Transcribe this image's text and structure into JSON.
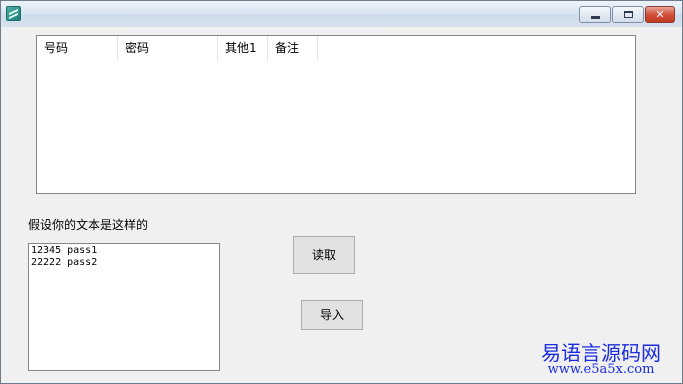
{
  "window": {
    "title": ""
  },
  "listview": {
    "columns": [
      "号码",
      "密码",
      "其他1",
      "备注"
    ]
  },
  "sample_label": "假设你的文本是这样的",
  "textbox": {
    "lines": [
      "12345 pass1",
      "22222 pass2"
    ]
  },
  "buttons": {
    "read": "读取",
    "import": "导入"
  },
  "watermark": {
    "name": "易语言源码网",
    "url": "www.e5a5x.com"
  },
  "colors": {
    "watermark": "#1a2be0",
    "close_button": "#c23a22"
  }
}
